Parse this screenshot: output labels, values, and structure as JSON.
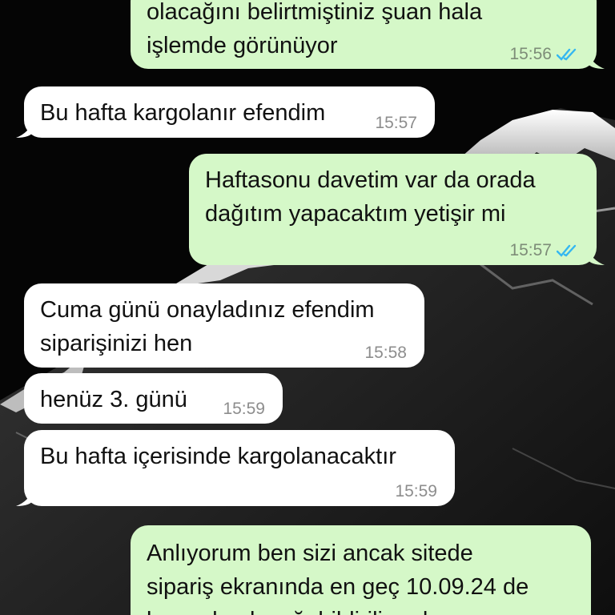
{
  "chat": {
    "messages": [
      {
        "direction": "outgoing",
        "text": "olacağını belirtmiştiniz şuan hala\nişlemde görünüyor",
        "time": "15:56",
        "status_icon": "double-check-read-icon"
      },
      {
        "direction": "incoming",
        "text": "Bu hafta kargolanır efendim",
        "time": "15:57"
      },
      {
        "direction": "outgoing",
        "text": "Haftasonu davetim var da orada\ndağıtım yapacaktım yetişir mi",
        "time": "15:57",
        "status_icon": "double-check-read-icon"
      },
      {
        "direction": "incoming",
        "text": "Cuma günü onayladınız efendim\nsiparişinizi hen",
        "time": "15:58"
      },
      {
        "direction": "incoming",
        "text": "henüz 3. günü",
        "time": "15:59"
      },
      {
        "direction": "incoming",
        "text": "Bu hafta içerisinde kargolanacaktır",
        "time": "15:59"
      },
      {
        "direction": "outgoing",
        "text": "Anlıyorum ben sizi ancak sitede\nsipariş ekranında en geç 10.09.24 de\nkargoda olacağı bildiriliyordu ona",
        "time": ""
      }
    ]
  },
  "colors": {
    "outgoing_bubble": "#d5f8c8",
    "incoming_bubble": "#ffffff",
    "read_check": "#34b7f1",
    "wallpaper": "#050505"
  }
}
